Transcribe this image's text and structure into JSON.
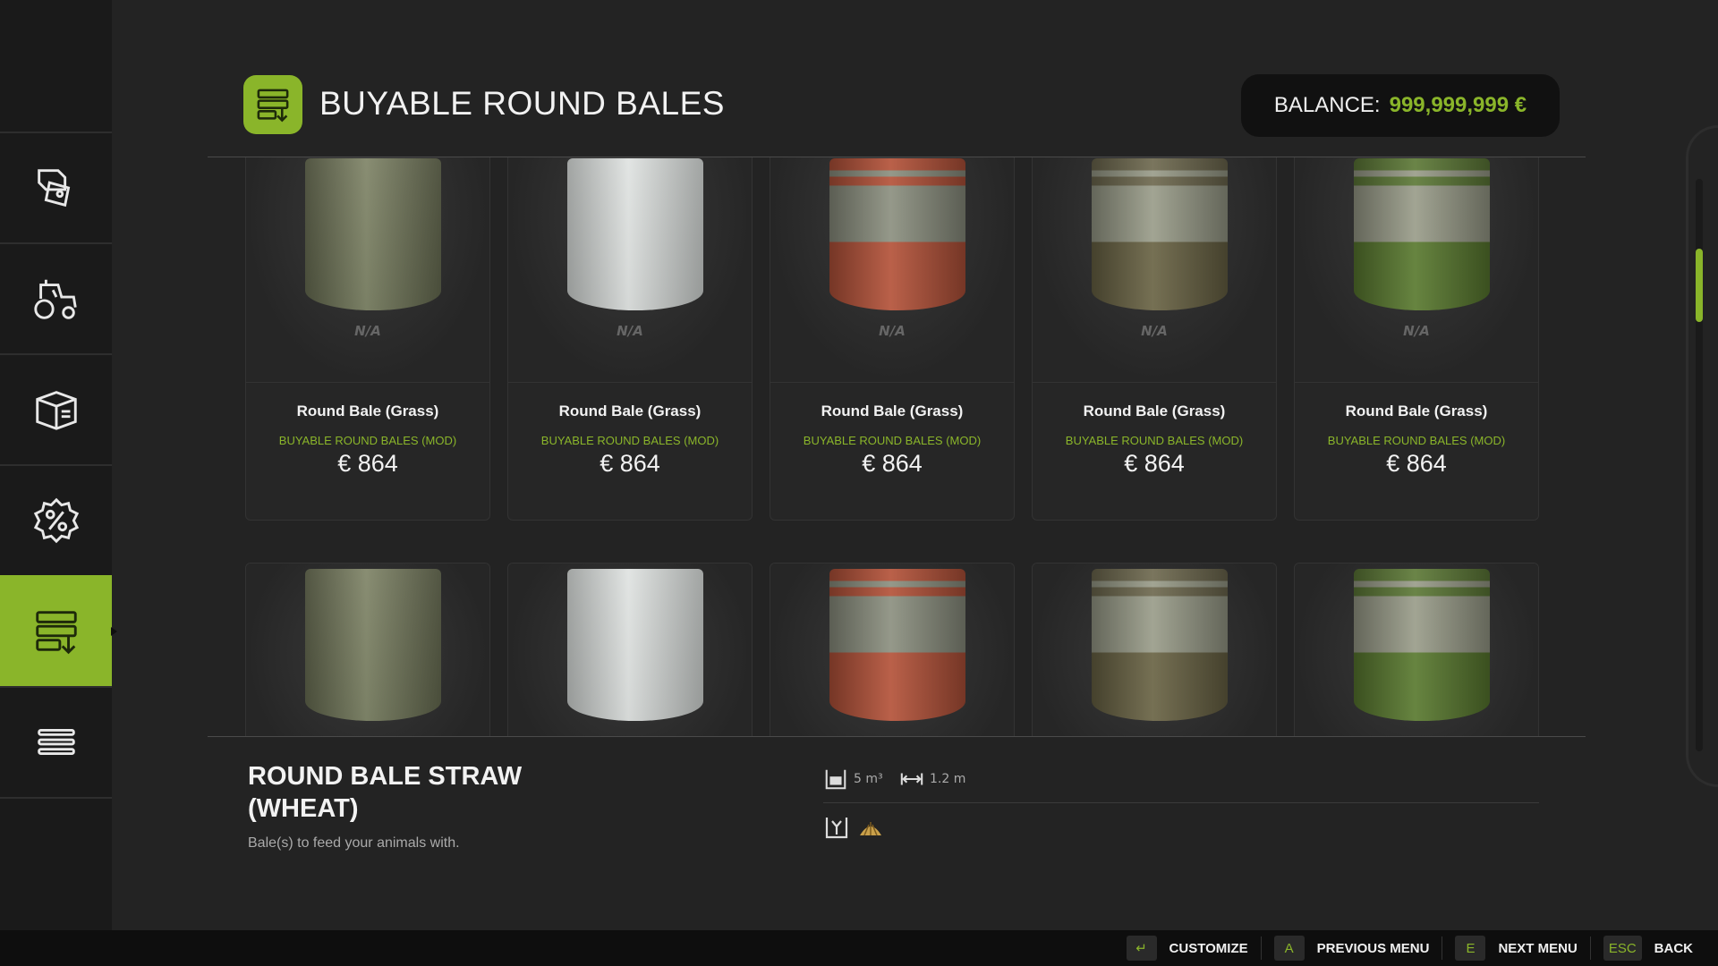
{
  "header": {
    "title": "BUYABLE ROUND BALES",
    "balance_label": "BALANCE:",
    "balance_value": "999,999,999 €"
  },
  "sidebar": {
    "items": [
      {
        "name": "sales-icon"
      },
      {
        "name": "tractor-icon"
      },
      {
        "name": "box-icon"
      },
      {
        "name": "percent-icon"
      },
      {
        "name": "bales-shop-icon",
        "active": true
      },
      {
        "name": "menu-list-icon"
      }
    ]
  },
  "cards_row1": [
    {
      "availability": "N/A",
      "name": "Round Bale (Grass)",
      "category": "BUYABLE ROUND BALES (MOD)",
      "price": "€ 864",
      "style": "grass"
    },
    {
      "availability": "N/A",
      "name": "Round Bale (Grass)",
      "category": "BUYABLE ROUND BALES (MOD)",
      "price": "€ 864",
      "style": "white"
    },
    {
      "availability": "N/A",
      "name": "Round Bale (Grass)",
      "category": "BUYABLE ROUND BALES (MOD)",
      "price": "€ 864",
      "style": "red"
    },
    {
      "availability": "N/A",
      "name": "Round Bale (Grass)",
      "category": "BUYABLE ROUND BALES (MOD)",
      "price": "€ 864",
      "style": "brown"
    },
    {
      "availability": "N/A",
      "name": "Round Bale (Grass)",
      "category": "BUYABLE ROUND BALES (MOD)",
      "price": "€ 864",
      "style": "green"
    }
  ],
  "cards_row2": [
    {
      "style": "grass"
    },
    {
      "style": "white"
    },
    {
      "style": "red"
    },
    {
      "style": "brown"
    },
    {
      "style": "green"
    }
  ],
  "details": {
    "title": "ROUND BALE STRAW (WHEAT)",
    "description": "Bale(s) to feed your animals with.",
    "volume": "5 m³",
    "width": "1.2 m",
    "fill_icons": [
      "animal-feed-icon",
      "straw-icon"
    ]
  },
  "footer": {
    "actions": [
      {
        "key": "↵",
        "label": "CUSTOMIZE"
      },
      {
        "key": "A",
        "label": "PREVIOUS MENU"
      },
      {
        "key": "E",
        "label": "NEXT MENU"
      },
      {
        "key": "ESC",
        "label": "BACK"
      }
    ]
  },
  "colors": {
    "accent": "#8ab52a",
    "background": "#232323",
    "sidebar": "#1a1a1a"
  }
}
